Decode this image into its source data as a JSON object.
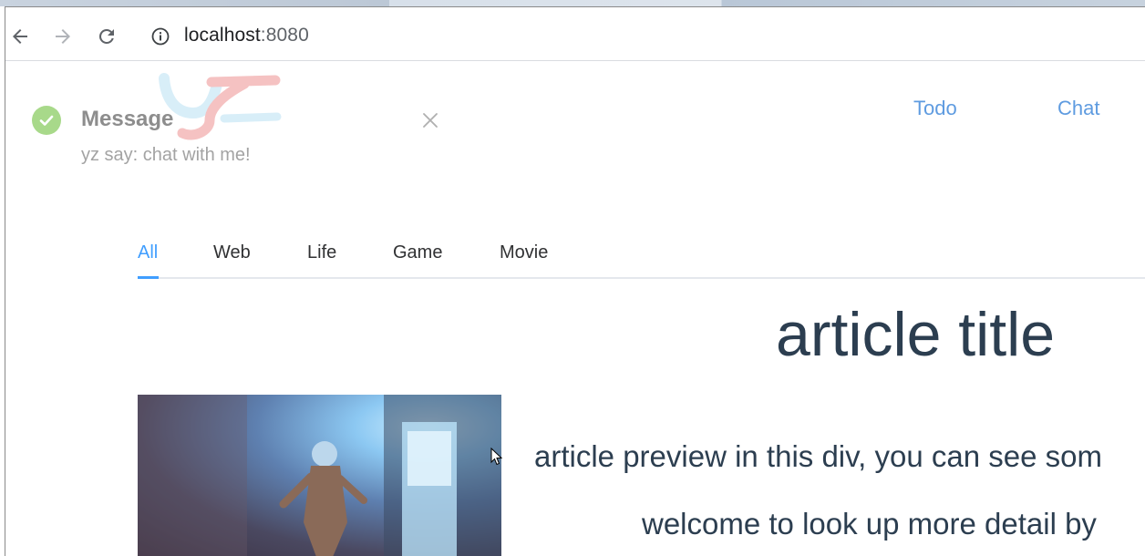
{
  "browser": {
    "url_host": "localhost",
    "url_port": ":8080"
  },
  "nav": {
    "todo": "Todo",
    "chat": "Chat"
  },
  "notification": {
    "title": "Message",
    "body": "yz say: chat with me!",
    "logo_text": "yz"
  },
  "tabs": [
    {
      "label": "All",
      "active": true
    },
    {
      "label": "Web",
      "active": false
    },
    {
      "label": "Life",
      "active": false
    },
    {
      "label": "Game",
      "active": false
    },
    {
      "label": "Movie",
      "active": false
    }
  ],
  "article": {
    "title": "article title",
    "preview": "article preview in this div, you can see som",
    "more": "welcome to look up more detail by"
  },
  "colors": {
    "accent": "#409eff",
    "nav_link": "#5e9be0",
    "success": "#a8d98a",
    "text": "#2c3e50"
  }
}
